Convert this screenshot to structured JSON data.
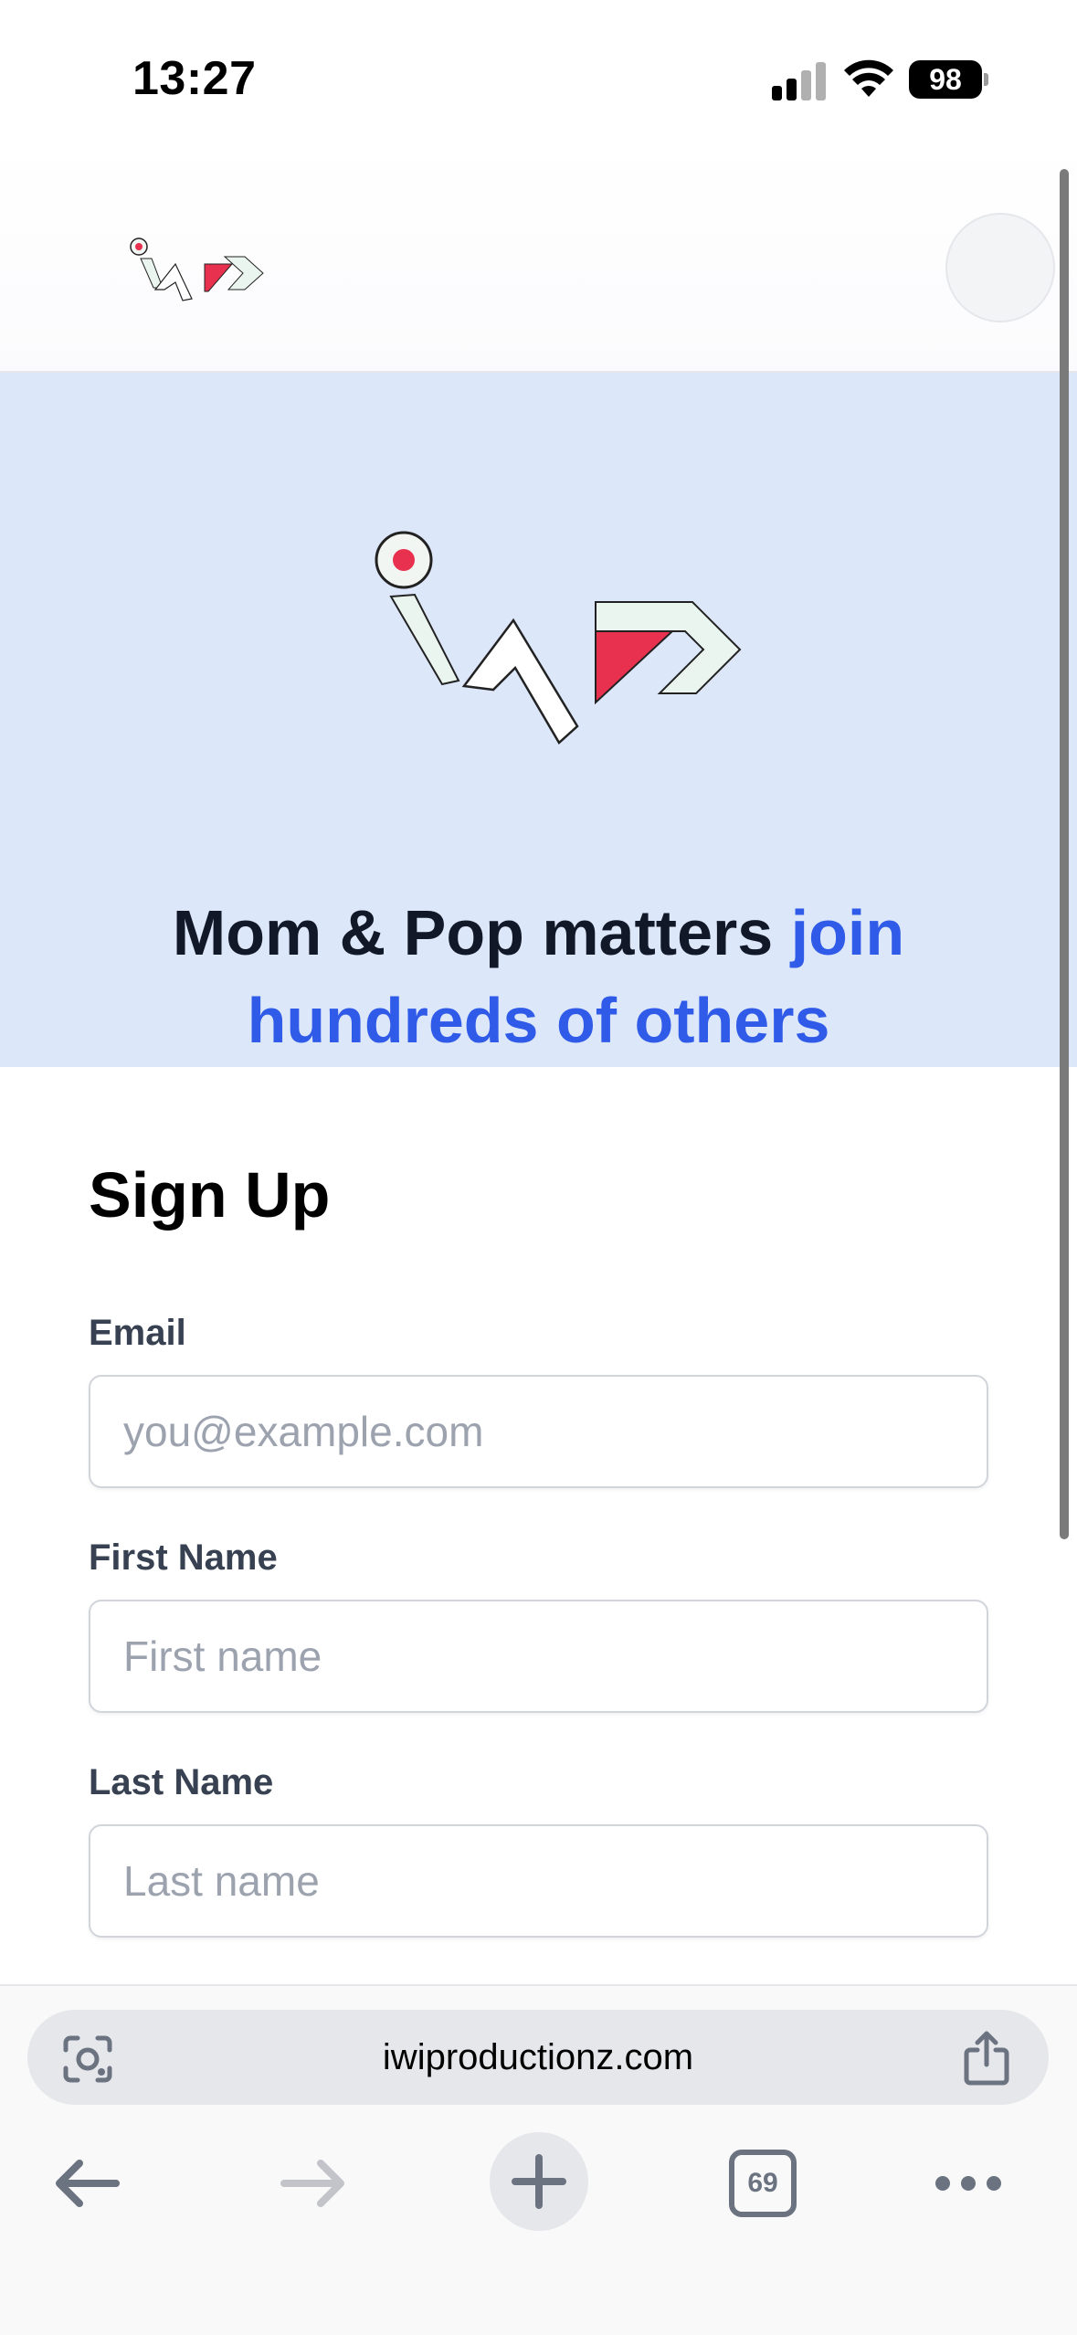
{
  "status_bar": {
    "time": "13:27",
    "battery": "98",
    "icons": [
      "signal-icon",
      "wifi-icon",
      "battery-icon"
    ]
  },
  "header": {
    "logo": "iwi-logo",
    "avatar": "avatar-icon"
  },
  "hero": {
    "title_main": "Mom & Pop matters ",
    "title_accent": "join hundreds of others",
    "accent_color": "#2f5be8",
    "background": "#dde7fa"
  },
  "form": {
    "title": "Sign Up",
    "fields": [
      {
        "label": "Email",
        "placeholder": "you@example.com"
      },
      {
        "label": "First Name",
        "placeholder": "First name"
      },
      {
        "label": "Last Name",
        "placeholder": "Last name"
      }
    ]
  },
  "browser": {
    "url": "iwiproductionz.com",
    "tab_count": "69",
    "icons": [
      "lens-icon",
      "share-icon",
      "back-arrow-icon",
      "forward-arrow-icon",
      "new-tab-plus-icon",
      "tabs-icon",
      "more-icon"
    ]
  }
}
